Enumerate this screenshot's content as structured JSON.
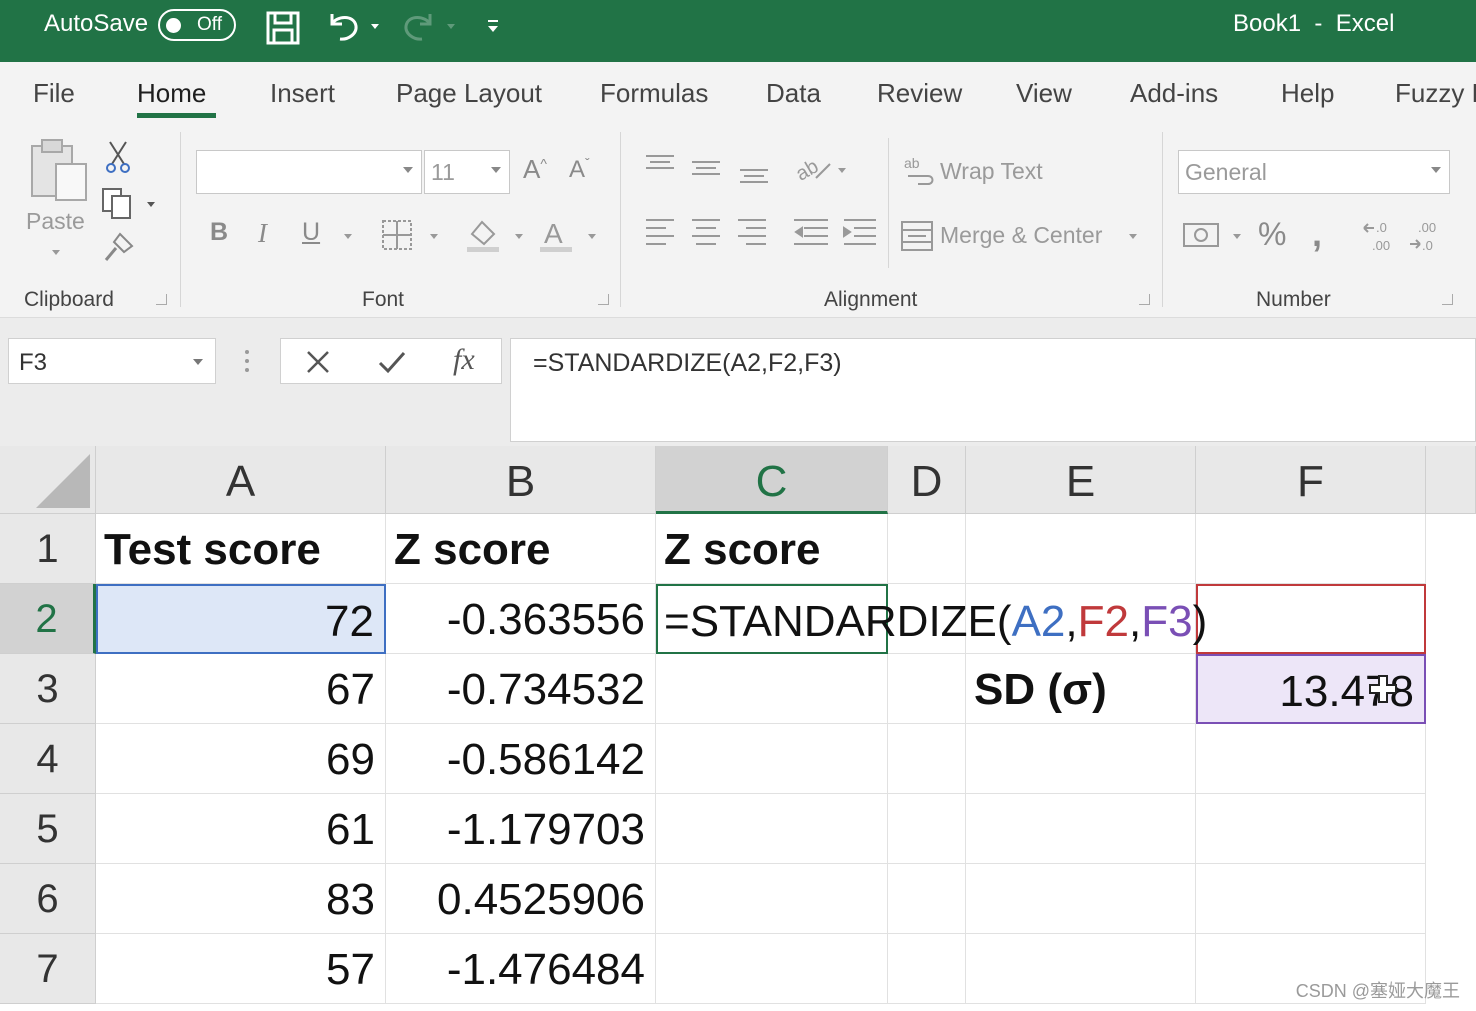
{
  "titlebar": {
    "autosave_label": "AutoSave",
    "autosave_state": "Off",
    "title": "Book1  -  Excel"
  },
  "tabs": [
    "File",
    "Home",
    "Insert",
    "Page Layout",
    "Formulas",
    "Data",
    "Review",
    "View",
    "Add-ins",
    "Help",
    "Fuzzy L"
  ],
  "active_tab": "Home",
  "ribbon": {
    "clipboard": {
      "paste_label": "Paste",
      "group_label": "Clipboard"
    },
    "font": {
      "font_name": "",
      "font_size": "11",
      "group_label": "Font"
    },
    "alignment": {
      "wrap_text": "Wrap Text",
      "merge_center": "Merge & Center",
      "group_label": "Alignment"
    },
    "number": {
      "format": "General",
      "group_label": "Number"
    }
  },
  "formula_bar": {
    "name_box": "F3",
    "formula": "=STANDARDIZE(A2,F2,F3)"
  },
  "columns": [
    "A",
    "B",
    "C",
    "D",
    "E",
    "F"
  ],
  "rows": [
    "1",
    "2",
    "3",
    "4",
    "5",
    "6",
    "7"
  ],
  "headers": {
    "a1": "Test score",
    "b1": "Z score",
    "c1": "Z score"
  },
  "test_scores": [
    "72",
    "67",
    "69",
    "61",
    "83",
    "57"
  ],
  "z_scores": [
    "-0.363556",
    "-0.734532",
    "-0.586142",
    "-1.179703",
    "0.4525906",
    "-1.476484"
  ],
  "c2_formula": {
    "prefix": "=STANDARDIZE(",
    "ref1": "A2",
    "sep1": ",",
    "ref2": "F2",
    "sep2": ",",
    "ref3": "F3",
    "suffix": ")"
  },
  "e3_label": "SD (σ)",
  "f3_value": "13.478",
  "watermark": "CSDN @塞娅大魔王",
  "colors": {
    "excel_green": "#217346",
    "ref_blue": "#3e6fc2",
    "ref_red": "#c0393b",
    "ref_purple": "#7a4fb5"
  }
}
